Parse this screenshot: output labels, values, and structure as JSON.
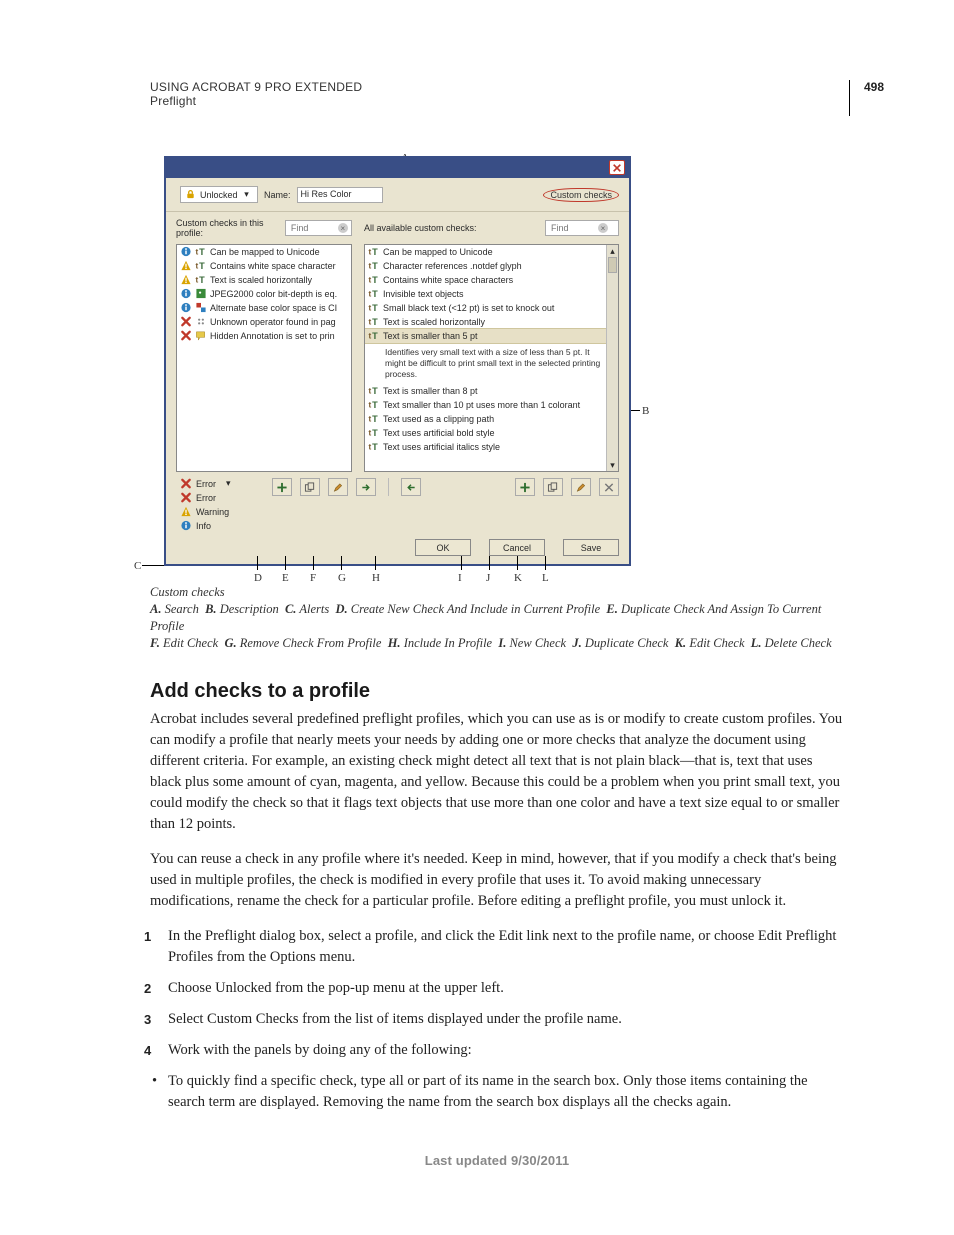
{
  "page_number": "498",
  "running_head": "USING ACROBAT 9 PRO EXTENDED",
  "running_sub": "Preflight",
  "dialog": {
    "unlocked_label": "Unlocked",
    "name_label": "Name:",
    "name_value": "Hi Res Color",
    "custom_checks_pill": "Custom checks",
    "left_header": "Custom checks in this profile:",
    "right_header": "All available custom checks:",
    "find_placeholder": "Find",
    "left_items": [
      {
        "status": "info",
        "icon": "tT",
        "text": "Can be mapped to Unicode"
      },
      {
        "status": "warn",
        "icon": "tT",
        "text": "Contains white space character"
      },
      {
        "status": "warn",
        "icon": "tT",
        "text": "Text is scaled horizontally"
      },
      {
        "status": "info",
        "icon": "jp",
        "text": "JPEG2000 color bit-depth is eq."
      },
      {
        "status": "info",
        "icon": "sw",
        "text": "Alternate base color space is CI"
      },
      {
        "status": "err",
        "icon": "op",
        "text": "Unknown operator found in pag"
      },
      {
        "status": "err",
        "icon": "an",
        "text": "Hidden Annotation is set to prin"
      }
    ],
    "right_items": [
      {
        "icon": "tT",
        "text": "Can be mapped to Unicode"
      },
      {
        "icon": "tT",
        "text": "Character references .notdef glyph"
      },
      {
        "icon": "tT",
        "text": "Contains white space characters"
      },
      {
        "icon": "tT",
        "text": "Invisible text objects"
      },
      {
        "icon": "tT",
        "text": "Small black text (<12 pt) is set to knock out"
      },
      {
        "icon": "tT",
        "text": "Text is scaled horizontally"
      },
      {
        "icon": "tT",
        "text": "Text is smaller than 5 pt",
        "selected": true
      },
      {
        "icon": "tT",
        "text": "Text is smaller than 8 pt"
      },
      {
        "icon": "tT",
        "text": "Text smaller than 10 pt uses more than 1 colorant"
      },
      {
        "icon": "tT",
        "text": "Text used as a clipping path"
      },
      {
        "icon": "tT",
        "text": "Text uses artificial bold style"
      },
      {
        "icon": "tT",
        "text": "Text uses artificial italics style"
      }
    ],
    "description": "Identifies very small text with a size of less than 5 pt. It might be difficult to print small text in the selected printing process.",
    "legend_error": "Error",
    "legend_error2": "Error",
    "legend_warning": "Warning",
    "legend_info": "Info",
    "btn_ok": "OK",
    "btn_cancel": "Cancel",
    "btn_save": "Save"
  },
  "callouts": {
    "A": "A",
    "B": "B",
    "C": "C"
  },
  "key_row_top": [
    "D",
    "E",
    "F",
    "G",
    "H",
    "",
    "I",
    "J",
    "K",
    "L"
  ],
  "caption_title": "Custom checks",
  "caption_line1_parts": [
    {
      "k": "A.",
      "v": "Search"
    },
    {
      "k": "B.",
      "v": "Description"
    },
    {
      "k": "C.",
      "v": "Alerts"
    },
    {
      "k": "D.",
      "v": "Create New Check And Include in Current Profile"
    },
    {
      "k": "E.",
      "v": "Duplicate Check And Assign To Current Profile"
    }
  ],
  "caption_line2_parts": [
    {
      "k": "F.",
      "v": "Edit Check"
    },
    {
      "k": "G.",
      "v": "Remove Check From Profile"
    },
    {
      "k": "H.",
      "v": "Include In Profile"
    },
    {
      "k": "I.",
      "v": "New Check"
    },
    {
      "k": "J.",
      "v": "Duplicate Check"
    },
    {
      "k": "K.",
      "v": "Edit Check"
    },
    {
      "k": "L.",
      "v": "Delete Check"
    }
  ],
  "heading": "Add checks to a profile",
  "para1": "Acrobat includes several predefined preflight profiles, which you can use as is or modify to create custom profiles. You can modify a profile that nearly meets your needs by adding one or more checks that analyze the document using different criteria. For example, an existing check might detect all text that is not plain black—that is, text that uses black plus some amount of cyan, magenta, and yellow. Because this could be a problem when you print small text, you could modify the check so that it flags text objects that use more than one color and have a text size equal to or smaller than 12 points.",
  "para2": "You can reuse a check in any profile where it's needed. Keep in mind, however, that if you modify a check that's being used in multiple profiles, the check is modified in every profile that uses it. To avoid making unnecessary modifications, rename the check for a particular profile. Before editing a preflight profile, you must unlock it.",
  "steps": [
    "In the Preflight dialog box, select a profile, and click the Edit link next to the profile name, or choose Edit Preflight Profiles from the Options menu.",
    "Choose Unlocked from the pop-up menu at the upper left.",
    "Select Custom Checks from the list of items displayed under the profile name.",
    "Work with the panels by doing any of the following:"
  ],
  "bullets": [
    "To quickly find a specific check, type all or part of its name in the search box. Only those items containing the search term are displayed. Removing the name from the search box displays all the checks again."
  ],
  "updated": "Last updated 9/30/2011"
}
